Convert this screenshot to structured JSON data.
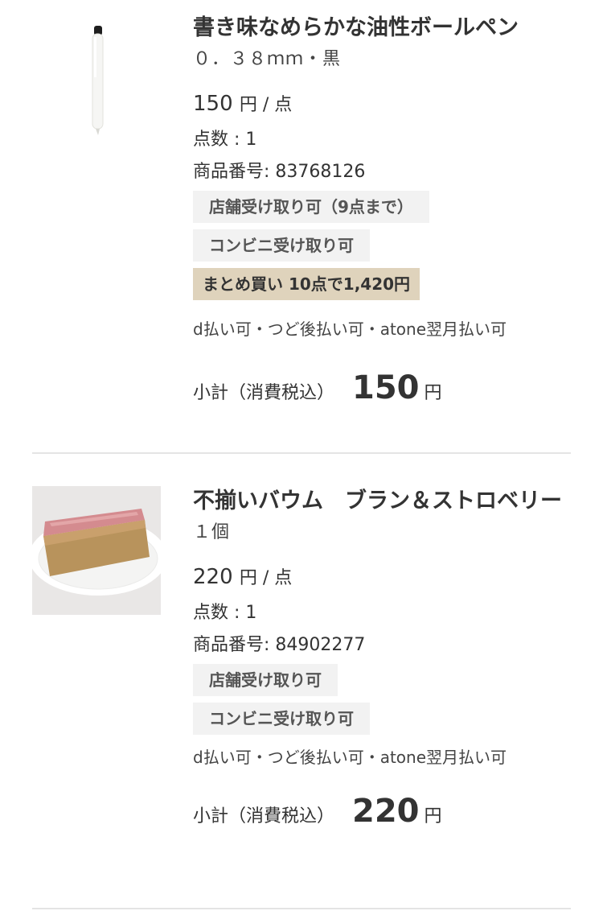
{
  "items": [
    {
      "title": "書き味なめらかな油性ボールペン",
      "variant": "０．３８ｍｍ・黒",
      "price": "150",
      "price_unit": "円 / 点",
      "quantity": "点数 : 1",
      "product_code": "商品番号: 83768126",
      "tags": [
        "店舗受け取り可（9点まで）",
        "コンビニ受け取り可"
      ],
      "promo": "まとめ買い 10点で1,420円",
      "payment": "d払い可・つど後払い可・atone翌月払い可",
      "subtotal_label": "小計（消費税込）",
      "subtotal": "150",
      "subtotal_unit": "円"
    },
    {
      "title": "不揃いバウム　ブラン＆ストロベリー",
      "variant": "１個",
      "price": "220",
      "price_unit": "円 / 点",
      "quantity": "点数 : 1",
      "product_code": "商品番号: 84902277",
      "tags": [
        "店舗受け取り可",
        "コンビニ受け取り可"
      ],
      "payment": "d払い可・つど後払い可・atone翌月払い可",
      "subtotal_label": "小計（消費税込）",
      "subtotal": "220",
      "subtotal_unit": "円"
    }
  ]
}
